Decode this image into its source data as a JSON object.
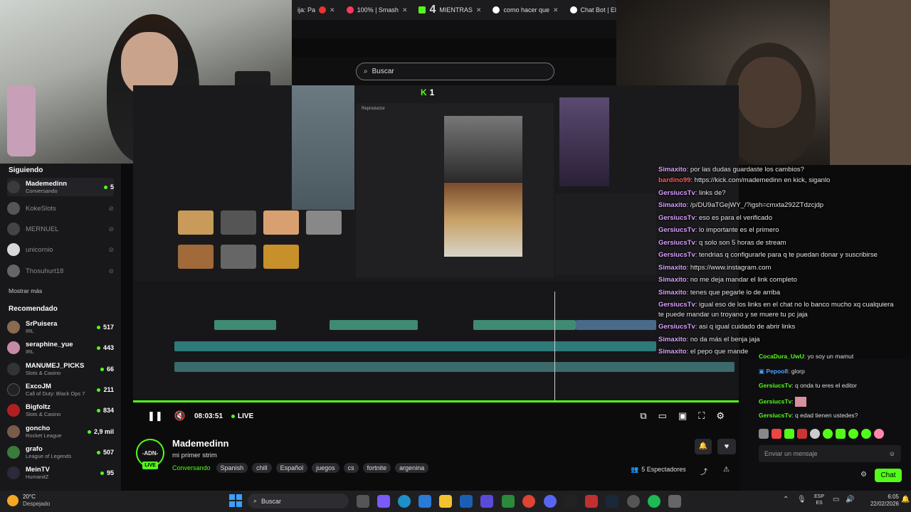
{
  "browser": {
    "tabs": [
      {
        "label": "ija: Pa"
      },
      {
        "label": "100% | Smash"
      },
      {
        "label": "MIENTRAS"
      },
      {
        "label": "como hacer que"
      },
      {
        "label": "Chat Bot | El"
      }
    ]
  },
  "search": {
    "placeholder": "Buscar"
  },
  "editor": {
    "badge_prefix": "K",
    "badge_value": "1",
    "player_label": "Reproductor",
    "k4": "4"
  },
  "player": {
    "time": "08:03:51",
    "live_label": "LIVE"
  },
  "sidebar": {
    "following_title": "Siguiendo",
    "following": [
      {
        "name": "Mademedinn",
        "category": "Conversando",
        "count": "5",
        "live": true,
        "color": "#3a3a3a"
      },
      {
        "name": "KokeSlots",
        "live": false,
        "color": "#555"
      },
      {
        "name": "MERNUEL",
        "live": false,
        "color": "#444"
      },
      {
        "name": "unicornio",
        "live": false,
        "color": "#d8d8d8"
      },
      {
        "name": "Thosuhurt18",
        "live": false,
        "color": "#666"
      }
    ],
    "show_more": "Mostrar más",
    "recommended_title": "Recomendado",
    "recommended": [
      {
        "name": "SrPuisera",
        "category": "IRL",
        "count": "517",
        "color": "#8a6a50"
      },
      {
        "name": "seraphine_yue",
        "category": "IRL",
        "count": "443",
        "color": "#c78aa6"
      },
      {
        "name": "MANUMEJ_PICKS",
        "category": "Slots & Casino",
        "count": "66",
        "color": "#333"
      },
      {
        "name": "ExcoJM",
        "category": "Call of Duty: Black Ops 7",
        "count": "211",
        "color": "#222"
      },
      {
        "name": "Bigfoltz",
        "category": "Slots & Casino",
        "count": "834",
        "color": "#b02020"
      },
      {
        "name": "goncho",
        "category": "Rocket League",
        "count": "2,9 mil",
        "color": "#7a5a4a"
      },
      {
        "name": "grafo",
        "category": "League of Legends",
        "count": "507",
        "color": "#3a7a3a"
      },
      {
        "name": "MeinTV",
        "category": "HumanitZ",
        "count": "95",
        "color": "#2a2a3a"
      }
    ]
  },
  "stream": {
    "logo_text": "-ADN-",
    "live_badge": "LIVE",
    "title": "Mademedinn",
    "subtitle": "mi primer strim",
    "category": "Conversando",
    "tags": [
      "Spanish",
      "chill",
      "Español",
      "juegos",
      "cs",
      "fortnite",
      "argenina"
    ],
    "viewers": "5 Espectadores"
  },
  "overlay_chat": [
    {
      "user": "Simaxito",
      "text": ": por las dudas guardaste los cambios?",
      "color": "#d8a0ff"
    },
    {
      "user": "bardino99",
      "text": ": https://kick.com/mademedinn en kick, siganlo",
      "color": "#ff5c5c"
    },
    {
      "user": "GersiucsTv",
      "text": ": links de?",
      "color": "#d8a0ff"
    },
    {
      "user": "Simaxito",
      "text": ": /p/DU9aTGejWY_/?igsh=cmxta292ZTdzcjdp",
      "color": "#d8a0ff"
    },
    {
      "user": "GersiucsTv",
      "text": ": eso es para el verificado",
      "color": "#d8a0ff"
    },
    {
      "user": "GersiucsTv",
      "text": ": lo importante es el primero",
      "color": "#d8a0ff"
    },
    {
      "user": "GersiucsTv",
      "text": ": q solo son 5 horas de stream",
      "color": "#d8a0ff"
    },
    {
      "user": "GersiucsTv",
      "text": ": tendrias q configurarle para q te puedan donar y suscribirse",
      "color": "#d8a0ff"
    },
    {
      "user": "Simaxito",
      "text": ": https://www.instagram.com",
      "color": "#d8a0ff"
    },
    {
      "user": "Simaxito",
      "text": ": no me deja mandar el link completo",
      "color": "#d8a0ff"
    },
    {
      "user": "Simaxito",
      "text": ": tenes que pegarle lo de arriba",
      "color": "#d8a0ff"
    },
    {
      "user": "GersiucsTv",
      "text": ": igual eso de los links en el chat no lo banco mucho xq cualquiera",
      "color": "#d8a0ff"
    },
    {
      "user": "",
      "text": "te puede mandar un troyano y se muere tu pc jaja",
      "color": "#d8a0ff"
    },
    {
      "user": "GersiucsTv",
      "text": ": asi q igual cuidado de abrir links",
      "color": "#d8a0ff"
    },
    {
      "user": "Simaxito",
      "text": ": no da más el benja jaja",
      "color": "#d8a0ff"
    },
    {
      "user": "Simaxito",
      "text": ": el pepo que mande",
      "color": "#d8a0ff"
    }
  ],
  "kick_chat": [
    {
      "user": "CocaDura_UwU",
      "text": ": yo soy un mamut",
      "color": "#53fc18"
    },
    {
      "user": "Pepoo8",
      "text": ": glorp",
      "color": "#4aa0ff"
    },
    {
      "user": "GersiucsTv",
      "text": ": q onda tu eres el editor",
      "color": "#53fc18"
    },
    {
      "user": "GersiucsTv",
      "text": ":",
      "color": "#53fc18"
    },
    {
      "user": "GersiucsTv",
      "text": ": q edad tienen ustedes?",
      "color": "#53fc18"
    }
  ],
  "chat_input": {
    "placeholder": "Enviar un mensaje",
    "send_label": "Chat"
  },
  "taskbar": {
    "weather_temp": "20°C",
    "weather_desc": "Despejado",
    "search_label": "Buscar",
    "lang": "ESP",
    "lang_sub": "ES",
    "time": "6:05",
    "date": "22/02/2026"
  }
}
